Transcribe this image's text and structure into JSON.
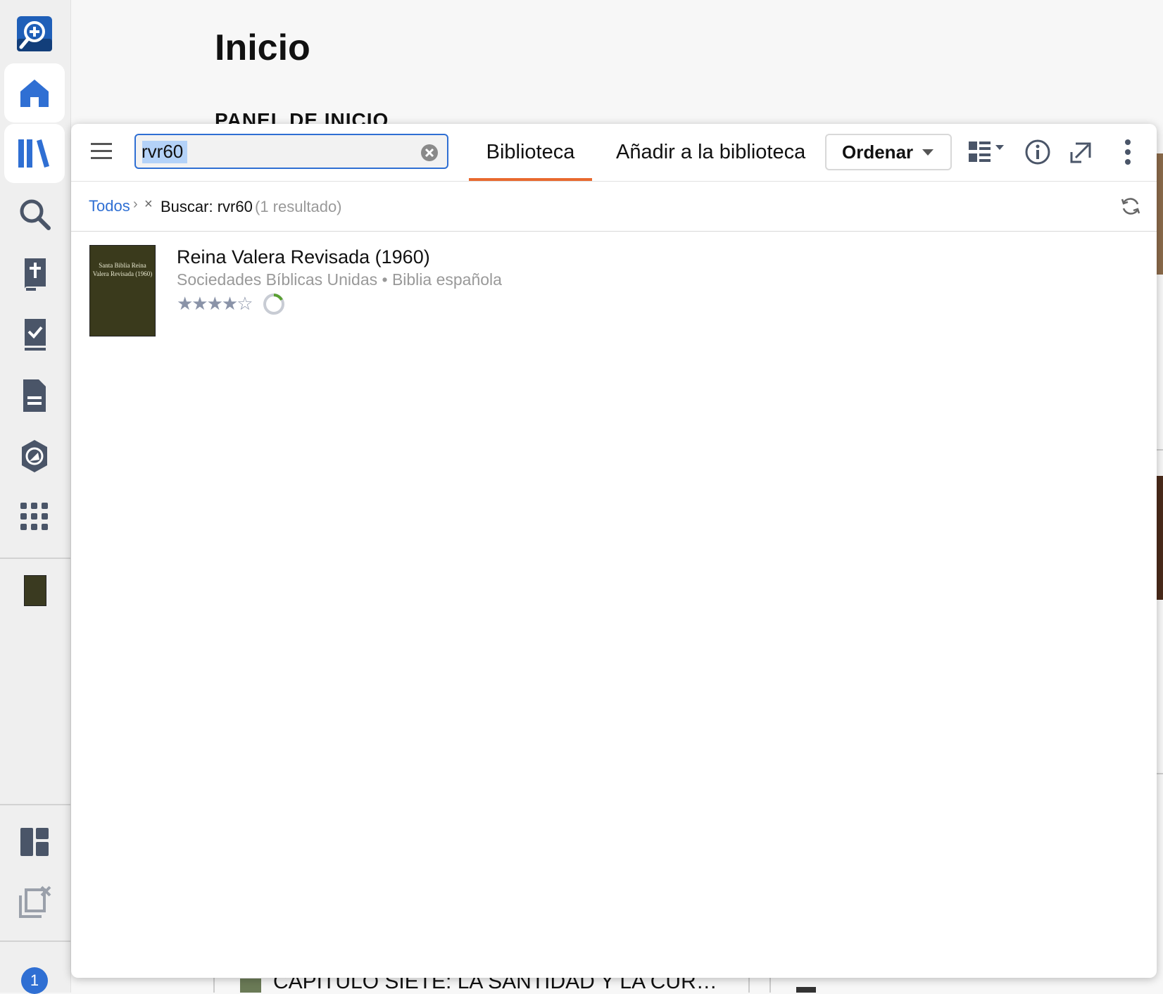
{
  "background": {
    "page_title": "Inicio",
    "panel_heading": "PANEL DE INICIO",
    "chapter_text": "CAPITULO SIETE: LA SANTIDAD Y LA CUR…"
  },
  "sidebar": {
    "items": [
      {
        "name": "search-logo"
      },
      {
        "name": "home"
      },
      {
        "name": "library"
      },
      {
        "name": "search"
      },
      {
        "name": "bible"
      },
      {
        "name": "reading-plan"
      },
      {
        "name": "documents"
      },
      {
        "name": "guides"
      },
      {
        "name": "apps"
      }
    ],
    "badge": "1"
  },
  "toolbar": {
    "search_value": "rvr60",
    "tabs": [
      {
        "label": "Biblioteca",
        "active": true
      },
      {
        "label": "Añadir a la biblioteca",
        "active": false
      }
    ],
    "sort_label": "Ordenar"
  },
  "breadcrumb": {
    "root": "Todos",
    "chevron": "›",
    "remove": "×",
    "search": "Buscar: rvr60",
    "count": "(1 resultado)"
  },
  "results": [
    {
      "title": "Reina Valera Revisada (1960)",
      "subtitle": "Sociedades Bíblicas Unidas • Biblia española",
      "rating_text": "★★★★☆",
      "cover_text": "Santa Biblia Reina Valera Revisada (1960)"
    }
  ],
  "colors": {
    "accent": "#2f6fd3",
    "tab_underline": "#e8692e",
    "icon": "#4a5568"
  }
}
